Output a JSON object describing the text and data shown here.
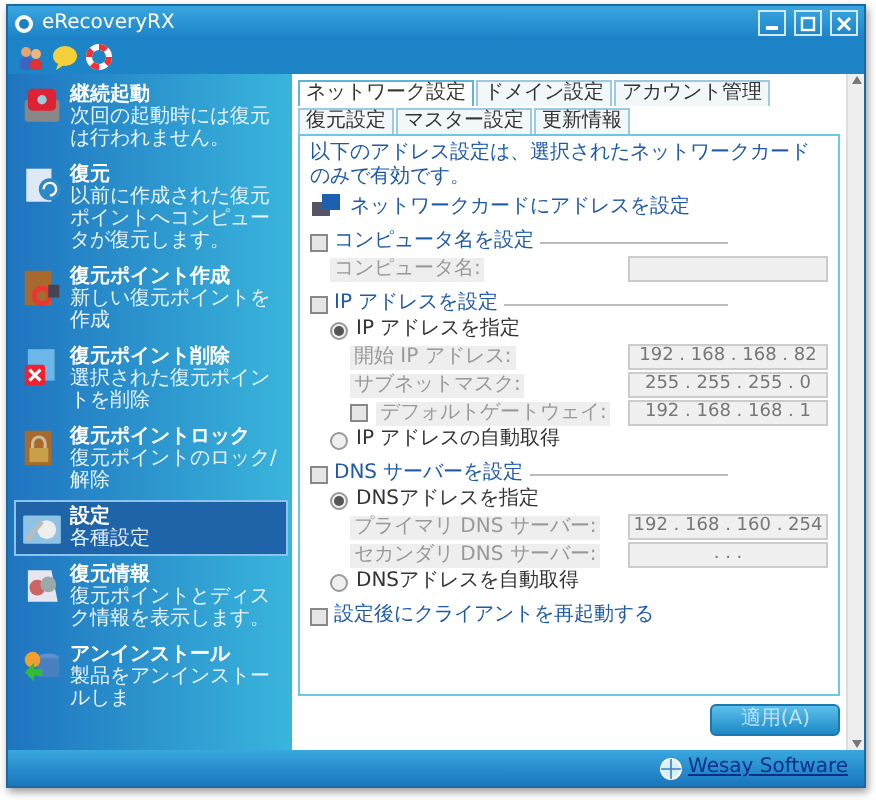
{
  "window": {
    "title": "eRecoveryRX"
  },
  "sidebar": {
    "items": [
      {
        "title": "継続起動",
        "description": "次回の起動時には復元は行われません。",
        "selected": false,
        "kind": "disk"
      },
      {
        "title": "復元",
        "description": "以前に作成された復元ポイントへコンピュータが復元します。",
        "selected": false,
        "kind": "restore"
      },
      {
        "title": "復元ポイント作成",
        "description": "新しい復元ポイントを作成",
        "selected": false,
        "kind": "create"
      },
      {
        "title": "復元ポイント削除",
        "description": "選択された復元ポイントを削除",
        "selected": false,
        "kind": "delete"
      },
      {
        "title": "復元ポイントロック",
        "description": "復元ポイントのロック/解除",
        "selected": false,
        "kind": "lock"
      },
      {
        "title": "設定",
        "description": "各種設定",
        "selected": true,
        "kind": "settings"
      },
      {
        "title": "復元情報",
        "description": "復元ポイントとディスク情報を表示します。",
        "selected": false,
        "kind": "info"
      },
      {
        "title": "アンインストール",
        "description": "製品をアンインストールしま",
        "selected": false,
        "kind": "uninstall"
      }
    ]
  },
  "tabs": [
    {
      "label": "ネットワーク設定",
      "selected": true
    },
    {
      "label": "ドメイン設定",
      "selected": false
    },
    {
      "label": "アカウント管理",
      "selected": false
    },
    {
      "label": "復元設定",
      "selected": false
    },
    {
      "label": "マスター設定",
      "selected": false
    },
    {
      "label": "更新情報",
      "selected": false
    }
  ],
  "form": [
    {
      "kind": "note",
      "text": "以下のアドレス設定は、選択されたネットワークカードのみで有効です。"
    },
    {
      "kind": "card",
      "text": "ネットワークカードにアドレスを設定"
    },
    {
      "kind": "section",
      "label": "コンピュータ名を設定",
      "checked": false,
      "children": [
        {
          "kind": "field",
          "label": "コンピュータ名:",
          "disabled": true
        }
      ]
    },
    {
      "kind": "section",
      "label": "IP アドレスを設定",
      "checked": false,
      "children": [
        {
          "kind": "radio",
          "label": "IP アドレスを指定",
          "selected": true,
          "children": [
            {
              "kind": "field",
              "label": "開始 IP アドレス:",
              "value": "192 . 168 . 168 . 82",
              "disabled": true
            },
            {
              "kind": "field",
              "label": "サブネットマスク:",
              "value": "255 . 255 . 255 . 0",
              "disabled": true
            },
            {
              "kind": "check_field",
              "label": "デフォルトゲートウェイ:",
              "checked": false,
              "value": "192 . 168 . 168 . 1",
              "disabled": true
            }
          ]
        },
        {
          "kind": "radio",
          "label": "IP アドレスの自動取得",
          "selected": false
        }
      ]
    },
    {
      "kind": "section",
      "label": "DNS サーバーを設定",
      "checked": false,
      "children": [
        {
          "kind": "radio",
          "label": "DNSアドレスを指定",
          "selected": true,
          "children": [
            {
              "kind": "field",
              "label": "プライマリ DNS サーバー:",
              "value": "192 . 168 . 160 . 254",
              "disabled": true
            },
            {
              "kind": "field",
              "label": "セカンダリ DNS サーバー:",
              "value": ". . .",
              "disabled": true
            }
          ]
        },
        {
          "kind": "radio",
          "label": "DNSアドレスを自動取得",
          "selected": false
        }
      ]
    },
    {
      "kind": "checkbox",
      "label": "設定後にクライアントを再起動する",
      "checked": false
    }
  ],
  "apply_button": {
    "label": "適用(A)",
    "disabled": true
  },
  "status_bar": {
    "link": "Wesay Software"
  }
}
